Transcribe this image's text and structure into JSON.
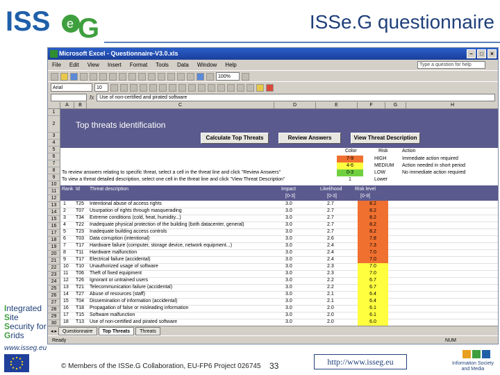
{
  "slide": {
    "title": "ISSe.G questionnaire",
    "logo_text": "ISSeG",
    "side_words": [
      "Integrated",
      "Site",
      "Security for",
      "Grids"
    ],
    "side_url": "www.isseg.eu",
    "copyright": "© Members of the ISSe.G Collaboration, EU-FP6 Project 026745",
    "page_number": "33",
    "footer_url": "http://www.isseg.eu",
    "isam_text": "Information Society and Media"
  },
  "excel": {
    "window_title": "Microsoft Excel - Questionnaire-V3.0.xls",
    "menu": [
      "File",
      "Edit",
      "View",
      "Insert",
      "Format",
      "Tools",
      "Data",
      "Window",
      "Help"
    ],
    "help_placeholder": "Type a question for help",
    "zoom": "100%",
    "font_name": "Arial",
    "font_size": "10",
    "formula_text": "Use of non-certified and pirated software",
    "columns": [
      "A",
      "B",
      "C",
      "D",
      "E",
      "F",
      "G",
      "H"
    ],
    "band_title": "Top threats identification",
    "buttons": {
      "calculate": "Calculate Top Threats",
      "review": "Review Answers",
      "view_desc": "View Threat Description"
    },
    "legend_headers": {
      "color": "Color",
      "risk": "Risk",
      "action": "Action"
    },
    "legend": [
      {
        "value": "7-9",
        "color": "#f07030",
        "risk": "HIGH",
        "action": "Immediate action required"
      },
      {
        "value": "4-6",
        "color": "#ffff40",
        "risk": "MEDIUM",
        "action": "Action needed in short period"
      },
      {
        "value": "0-3",
        "color": "#70d040",
        "risk": "LOW",
        "action": "No immediate action required"
      },
      {
        "value": "1",
        "color": "#ffffff",
        "risk": "Lower",
        "action": ""
      }
    ],
    "instructions": [
      "To review answers relating to specific threat, select a cell in the threat line and click \"Review Answers\"",
      "To view a threat detailed description, select one cell in the threat line and click \"View Threat Description\""
    ],
    "table_headers": {
      "rank": "Rank",
      "id": "Id",
      "desc": "Threat description",
      "impact": "Impact",
      "impact_range": "[0-3]",
      "likelihood": "Likelihood",
      "likelihood_range": "[0-3]",
      "risk": "Risk level",
      "risk_range": "[0-9]"
    },
    "rows": [
      {
        "rank": "1",
        "id": "T25",
        "desc": "Intentional abuse of access rights",
        "impact": "3.0",
        "likelihood": "2.7",
        "risk": "8.2",
        "color": "#f07030"
      },
      {
        "rank": "2",
        "id": "T07",
        "desc": "Usurpation of rights through masquerading",
        "impact": "3.0",
        "likelihood": "2.7",
        "risk": "8.2",
        "color": "#f07030"
      },
      {
        "rank": "3",
        "id": "T34",
        "desc": "Extreme conditions (cold, heat, humidity...)",
        "impact": "3.0",
        "likelihood": "2.7",
        "risk": "8.2",
        "color": "#f07030"
      },
      {
        "rank": "4",
        "id": "T22",
        "desc": "Inadequate physical protection of the building (both datacenter, general)",
        "impact": "3.0",
        "likelihood": "2.7",
        "risk": "8.2",
        "color": "#f07030"
      },
      {
        "rank": "5",
        "id": "T23",
        "desc": "Inadequate building access controls",
        "impact": "3.0",
        "likelihood": "2.7",
        "risk": "8.2",
        "color": "#f07030"
      },
      {
        "rank": "6",
        "id": "T03",
        "desc": "Data corruption (intentional)",
        "impact": "3.0",
        "likelihood": "2.6",
        "risk": "7.8",
        "color": "#f07030"
      },
      {
        "rank": "7",
        "id": "T17",
        "desc": "Hardware failure (computer, storage device, network equipment...)",
        "impact": "3.0",
        "likelihood": "2.4",
        "risk": "7.3",
        "color": "#f07030"
      },
      {
        "rank": "8",
        "id": "T11",
        "desc": "Hardware malfunction",
        "impact": "3.0",
        "likelihood": "2.4",
        "risk": "7.0",
        "color": "#f07030"
      },
      {
        "rank": "9",
        "id": "T17",
        "desc": "Electrical failure (accidental)",
        "impact": "3.0",
        "likelihood": "2.4",
        "risk": "7.0",
        "color": "#f07030"
      },
      {
        "rank": "10",
        "id": "T10",
        "desc": "Unauthorized usage of software",
        "impact": "3.0",
        "likelihood": "2.3",
        "risk": "7.0",
        "color": "#ffff40"
      },
      {
        "rank": "11",
        "id": "T06",
        "desc": "Theft of fixed equipment",
        "impact": "3.0",
        "likelihood": "2.3",
        "risk": "7.0",
        "color": "#ffff40"
      },
      {
        "rank": "12",
        "id": "T26",
        "desc": "Ignorant or untrained users",
        "impact": "3.0",
        "likelihood": "2.2",
        "risk": "6.7",
        "color": "#ffff40"
      },
      {
        "rank": "13",
        "id": "T21",
        "desc": "Telecommunication failure (accidental)",
        "impact": "3.0",
        "likelihood": "2.2",
        "risk": "6.7",
        "color": "#ffff40"
      },
      {
        "rank": "14",
        "id": "T27",
        "desc": "Abuse of resources (staff)",
        "impact": "3.0",
        "likelihood": "2.1",
        "risk": "6.4",
        "color": "#ffff40"
      },
      {
        "rank": "15",
        "id": "T04",
        "desc": "Dissemination of information (accidental)",
        "impact": "3.0",
        "likelihood": "2.1",
        "risk": "6.4",
        "color": "#ffff40"
      },
      {
        "rank": "16",
        "id": "T18",
        "desc": "Propagation of false or misleading information",
        "impact": "3.0",
        "likelihood": "2.0",
        "risk": "6.1",
        "color": "#ffff40"
      },
      {
        "rank": "17",
        "id": "T15",
        "desc": "Software malfunction",
        "impact": "3.0",
        "likelihood": "2.0",
        "risk": "6.1",
        "color": "#ffff40"
      },
      {
        "rank": "18",
        "id": "T13",
        "desc": "Use of non-certified and pirated software",
        "impact": "3.0",
        "likelihood": "2.0",
        "risk": "6.0",
        "color": "#ffff40"
      }
    ],
    "row_numbers": [
      "1",
      "2",
      "3",
      "4",
      "5",
      "6",
      "7",
      "8",
      "9",
      "10",
      "11",
      "12",
      "13",
      "14",
      "15",
      "16",
      "17",
      "18",
      "19",
      "20",
      "21",
      "22",
      "23",
      "24",
      "25",
      "26",
      "27",
      "28",
      "29",
      "30",
      "31"
    ],
    "sheet_tabs": [
      "Questionnaire",
      "Top Threats",
      "Threats"
    ],
    "status": "Ready",
    "status_num": "NUM"
  }
}
